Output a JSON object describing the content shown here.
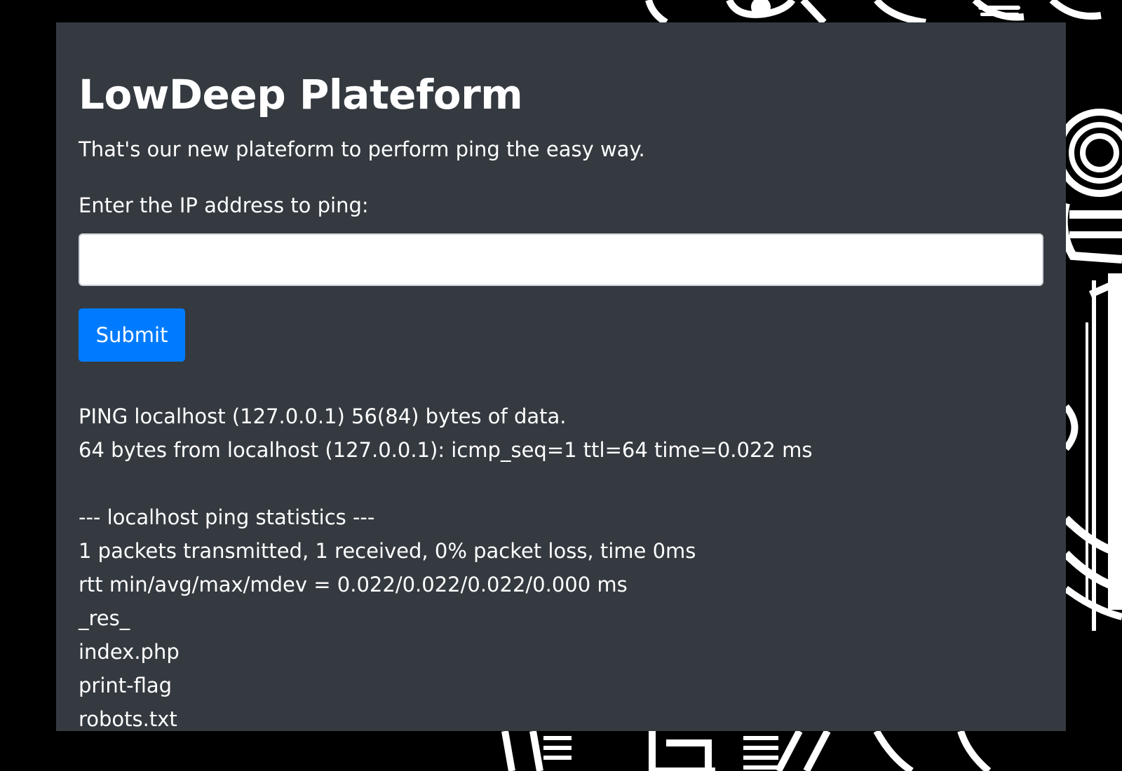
{
  "page": {
    "title": "LowDeep Plateform",
    "subtitle": "That's our new plateform to perform ping the easy way."
  },
  "form": {
    "label": "Enter the IP address to ping:",
    "input_value": "",
    "input_placeholder": "",
    "submit_label": "Submit"
  },
  "output": {
    "lines": [
      "PING localhost (127.0.0.1) 56(84) bytes of data.",
      "64 bytes from localhost (127.0.0.1): icmp_seq=1 ttl=64 time=0.022 ms",
      "",
      "--- localhost ping statistics ---",
      "1 packets transmitted, 1 received, 0% packet loss, time 0ms",
      "rtt min/avg/max/mdev = 0.022/0.022/0.022/0.000 ms",
      "_res_",
      "index.php",
      "print-flag",
      "robots.txt"
    ]
  },
  "colors": {
    "page_background": "#000000",
    "card_background": "#343a40",
    "text": "#ffffff",
    "button": "#007bff"
  }
}
